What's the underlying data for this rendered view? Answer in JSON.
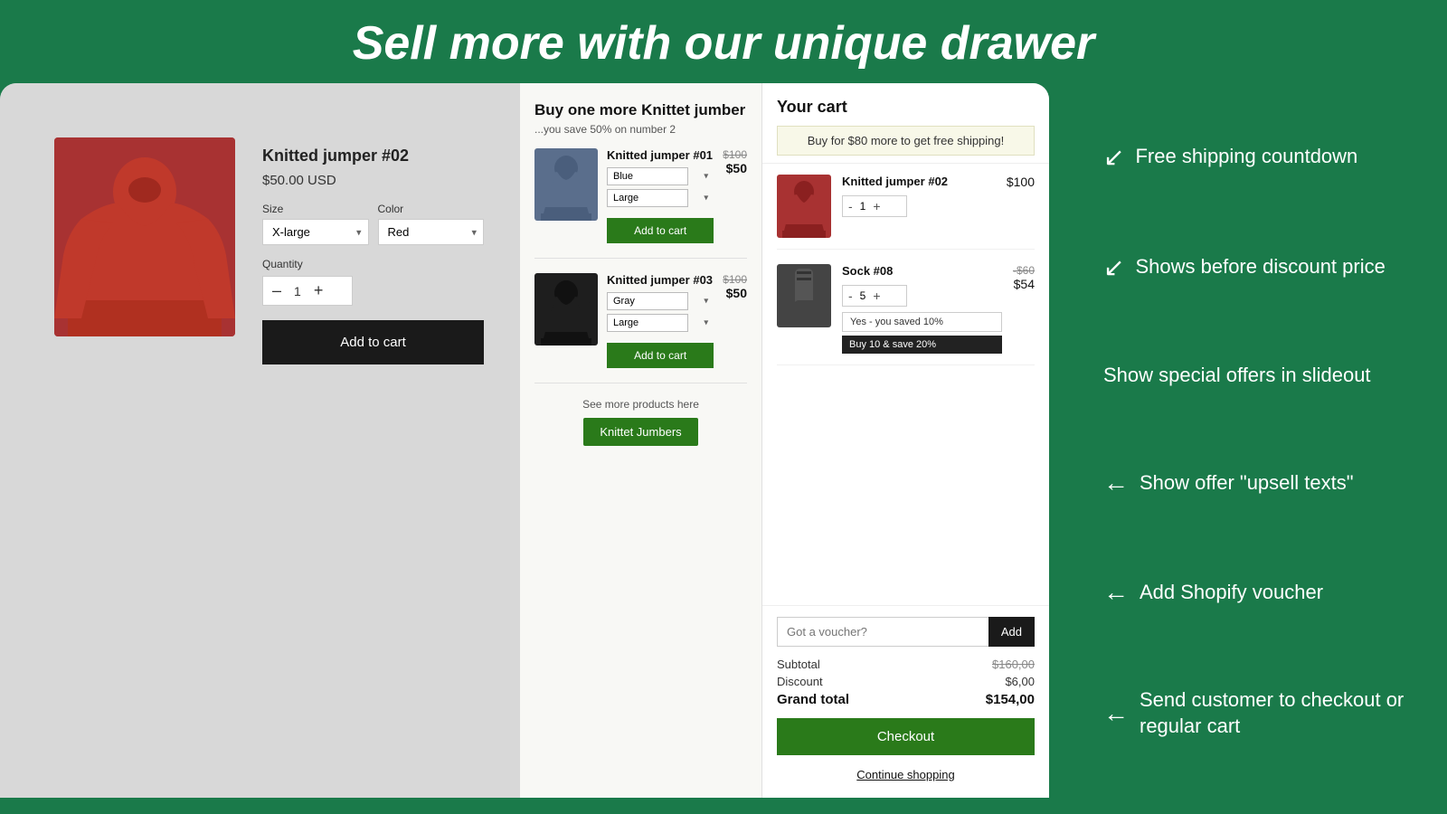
{
  "header": {
    "title": "Sell more with our unique drawer"
  },
  "product_page": {
    "product_name": "Knitted jumper #02",
    "price": "$50.00 USD",
    "size_label": "Size",
    "color_label": "Color",
    "size_value": "X-large",
    "color_value": "Red",
    "quantity_label": "Quantity",
    "quantity_value": "1",
    "qty_minus": "–",
    "qty_plus": "+",
    "add_to_cart": "Add to cart"
  },
  "upsell_drawer": {
    "title": "Buy one more Knittet jumber",
    "subtitle": "...you save 50% on number 2",
    "items": [
      {
        "name": "Knitted jumper #01",
        "color": "Blue",
        "size": "Large",
        "price_original": "$100",
        "price_current": "$50",
        "add_btn": "Add to cart"
      },
      {
        "name": "Knitted jumper #03",
        "color": "Gray",
        "size": "Large",
        "price_original": "$100",
        "price_current": "$50",
        "add_btn": "Add to cart"
      }
    ],
    "see_more_text": "See more products here",
    "see_more_btn": "Knittet Jumbers"
  },
  "cart_panel": {
    "title": "Your cart",
    "shipping_bar": "Buy for $80 more to get free shipping!",
    "items": [
      {
        "name": "Knitted jumper #02",
        "qty": "1",
        "price": "$100"
      },
      {
        "name": "Sock #08",
        "qty": "5",
        "price_original": "-$60",
        "price_current": "$54",
        "badge1": "Yes - you saved 10%",
        "badge2": "Buy 10 & save 20%"
      }
    ],
    "voucher_placeholder": "Got a voucher?",
    "voucher_btn": "Add",
    "subtotal_label": "Subtotal",
    "subtotal_value": "$160,00",
    "discount_label": "Discount",
    "discount_value": "$6,00",
    "grand_total_label": "Grand total",
    "grand_total_value": "$154,00",
    "checkout_btn": "Checkout",
    "continue_btn": "Continue shopping"
  },
  "annotations": [
    {
      "id": "free-shipping",
      "text": "Free shipping countdown"
    },
    {
      "id": "before-discount",
      "text": "Shows before discount price"
    },
    {
      "id": "special-offers",
      "text": "Show special offers in slideout"
    },
    {
      "id": "upsell-texts",
      "text": "Show offer \"upsell texts\""
    },
    {
      "id": "shopify-voucher",
      "text": "Add Shopify voucher"
    },
    {
      "id": "checkout",
      "text": "Send customer to checkout or regular cart"
    }
  ],
  "icons": {
    "arrow_left": "←",
    "chevron_down": "▾"
  }
}
